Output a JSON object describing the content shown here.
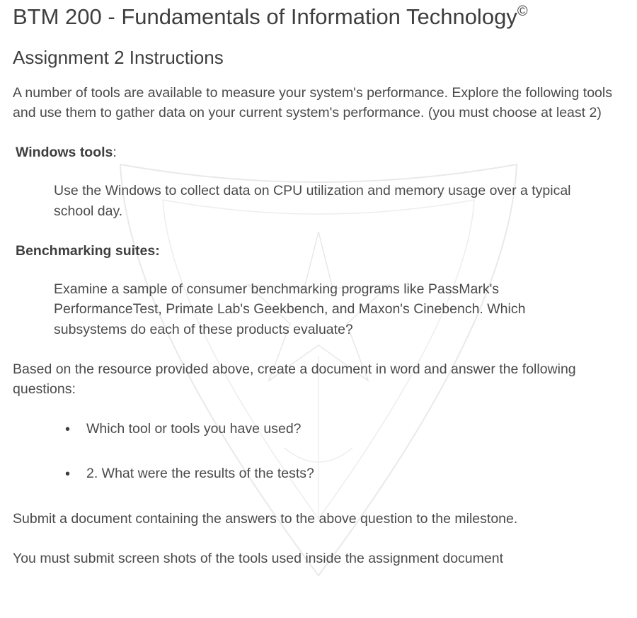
{
  "header": {
    "title": "BTM 200 - Fundamentals of Information Technology",
    "copyright_mark": "©",
    "subtitle": "Assignment 2 Instructions"
  },
  "intro": "A number of tools are available to measure your system's performance. Explore the following tools and use them to gather data on your current system's performance. (you must choose at least 2)",
  "sections": [
    {
      "label": "Windows tools",
      "label_suffix": ":",
      "text": "Use the Windows to collect data on CPU utilization and memory usage over a typical school day."
    },
    {
      "label": "Benchmarking suites:",
      "label_suffix": "",
      "text": "Examine a sample of consumer benchmarking programs like PassMark's PerformanceTest, Primate Lab's Geekbench, and Maxon's Cinebench. Which subsystems do each of these products evaluate?"
    }
  ],
  "after_sections": "Based on the resource provided above, create a document in word and answer the following questions:",
  "bullets": [
    "Which tool or tools you have used?",
    "2. What were the results of the tests?"
  ],
  "closing_1": "Submit a document containing the answers to the above question to the milestone.",
  "closing_2": "You must submit screen shots of the tools used inside the assignment document"
}
